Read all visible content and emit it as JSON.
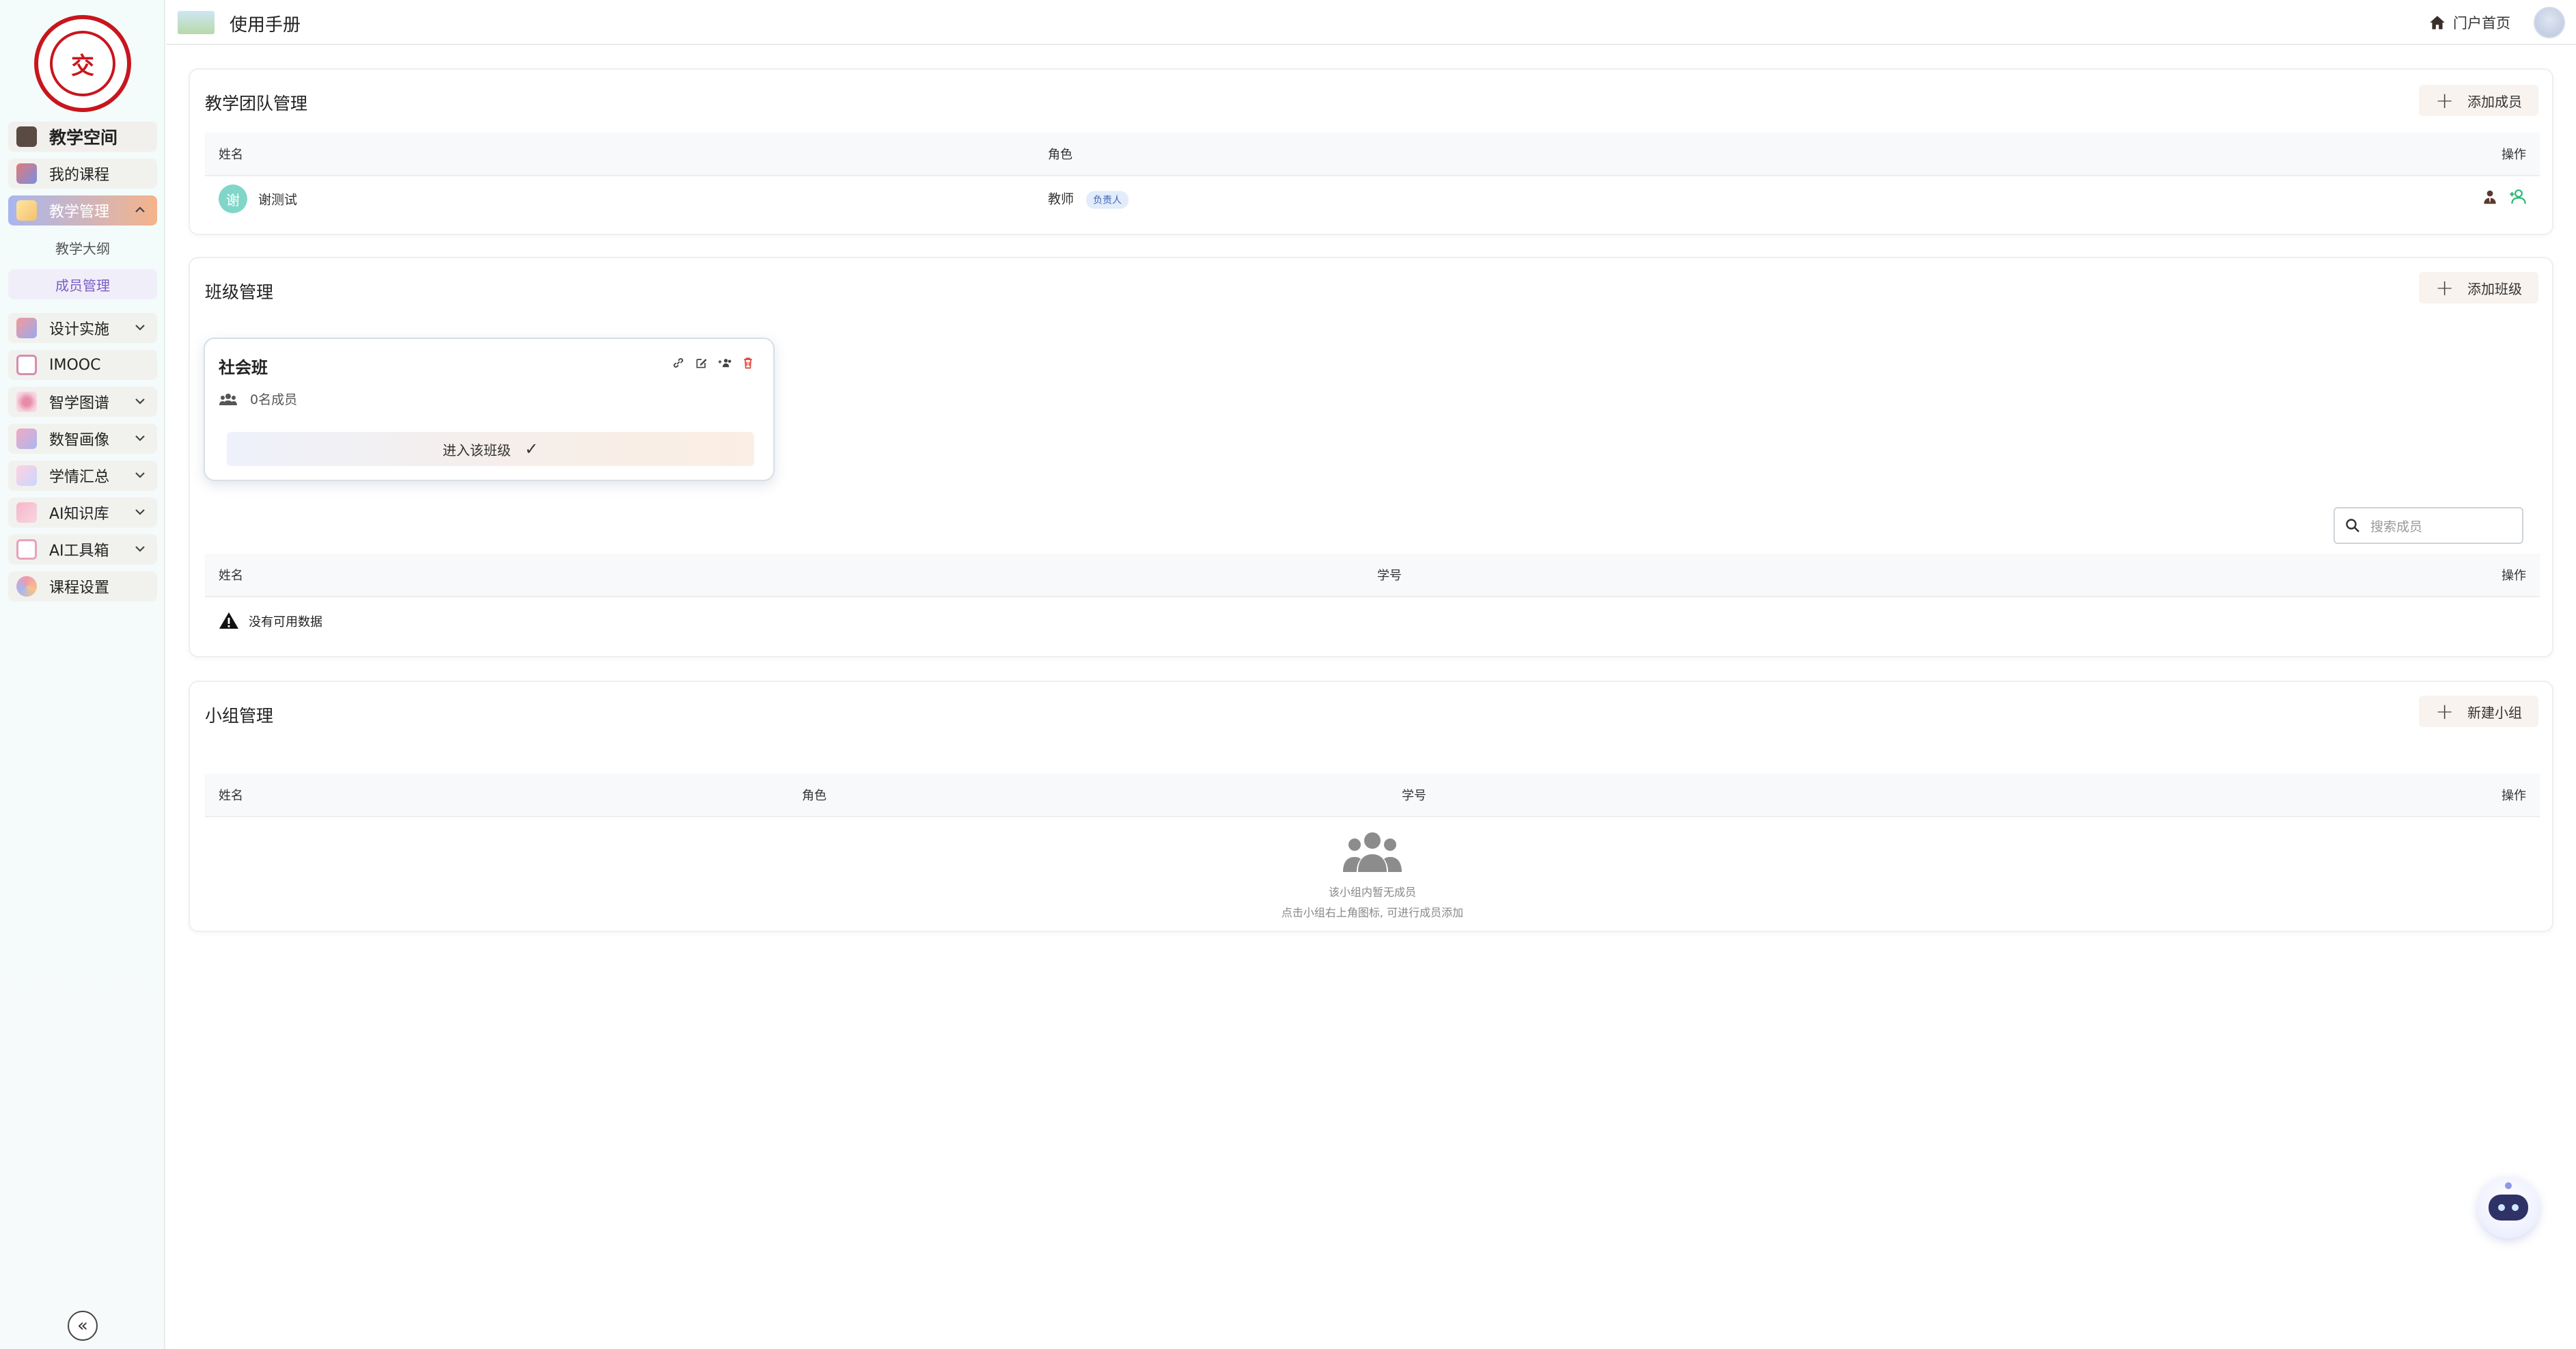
{
  "sidebar": {
    "header": "教学空间",
    "items": [
      {
        "label": "我的课程",
        "icon": "book-open-icon"
      },
      {
        "label": "教学管理",
        "icon": "teaching-icon"
      },
      {
        "label": "设计实施",
        "icon": "design-icon"
      },
      {
        "label": "IMOOC",
        "icon": "imooc-icon"
      },
      {
        "label": "智学图谱",
        "icon": "graph-icon"
      },
      {
        "label": "数智画像",
        "icon": "profile-chart-icon"
      },
      {
        "label": "学情汇总",
        "icon": "trend-icon"
      },
      {
        "label": "AI知识库",
        "icon": "knowledge-icon"
      },
      {
        "label": "AI工具箱",
        "icon": "toolbox-icon"
      },
      {
        "label": "课程设置",
        "icon": "settings-icon"
      }
    ],
    "sub_items": [
      {
        "label": "教学大纲"
      },
      {
        "label": "成员管理"
      }
    ],
    "collapse_symbol": "«"
  },
  "topbar": {
    "title": "使用手册",
    "portal_label": "门户首页"
  },
  "team": {
    "title": "教学团队管理",
    "add_label": "添加成员",
    "columns": [
      "姓名",
      "角色",
      "操作"
    ],
    "rows": [
      {
        "avatar_char": "谢",
        "name": "谢测试",
        "role": "教师",
        "badge": "负责人"
      }
    ]
  },
  "classes": {
    "title": "班级管理",
    "add_label": "添加班级",
    "class_card": {
      "name": "社会班",
      "member_count": "0名成员",
      "enter_label": "进入该班级",
      "check_symbol": "✓"
    },
    "search_placeholder": "搜索成员",
    "columns": [
      "姓名",
      "学号",
      "操作"
    ],
    "empty_text": "没有可用数据"
  },
  "groups": {
    "title": "小组管理",
    "add_label": "新建小组",
    "columns": [
      "姓名",
      "角色",
      "学号",
      "操作"
    ],
    "empty_line1": "该小组内暂无成员",
    "empty_line2": "点击小组右上角图标, 可进行成员添加"
  },
  "colors": {
    "active_nav_start": "#a7b6f0",
    "active_nav_end": "#f5b38a",
    "accent_green": "#2bb673",
    "delete_red": "#e0463a"
  }
}
